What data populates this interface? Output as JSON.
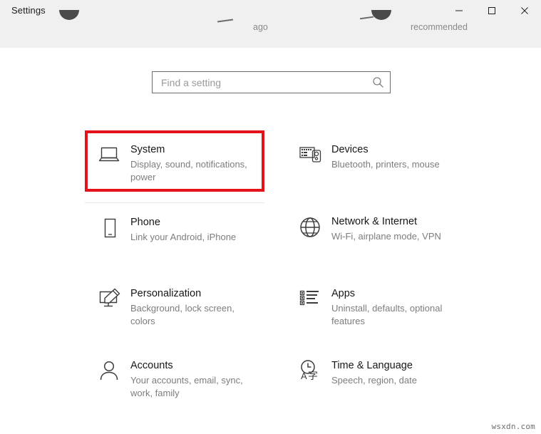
{
  "window": {
    "title": "Settings",
    "controls": [
      {
        "name": "minimize",
        "glyph": "minimize-icon"
      },
      {
        "name": "maximize",
        "glyph": "maximize-icon"
      },
      {
        "name": "close",
        "glyph": "close-icon"
      }
    ]
  },
  "clipped_row": {
    "fragment_ago": "ago",
    "fragment_recommended": "recommended"
  },
  "search": {
    "placeholder": "Find a setting",
    "value": "",
    "icon": "search-icon"
  },
  "highlight": {
    "color": "#e4121a",
    "target": "System"
  },
  "tiles": [
    {
      "id": "system",
      "icon": "laptop-icon",
      "title": "System",
      "subtitle": "Display, sound, notifications, power",
      "highlighted": true
    },
    {
      "id": "devices",
      "icon": "keyboard-mouse-icon",
      "title": "Devices",
      "subtitle": "Bluetooth, printers, mouse",
      "highlighted": false
    },
    {
      "id": "phone",
      "icon": "phone-icon",
      "title": "Phone",
      "subtitle": "Link your Android, iPhone",
      "highlighted": false
    },
    {
      "id": "network",
      "icon": "globe-icon",
      "title": "Network & Internet",
      "subtitle": "Wi-Fi, airplane mode, VPN",
      "highlighted": false
    },
    {
      "id": "personalization",
      "icon": "brush-monitor-icon",
      "title": "Personalization",
      "subtitle": "Background, lock screen, colors",
      "highlighted": false
    },
    {
      "id": "apps",
      "icon": "list-icon",
      "title": "Apps",
      "subtitle": "Uninstall, defaults, optional features",
      "highlighted": false
    },
    {
      "id": "accounts",
      "icon": "person-icon",
      "title": "Accounts",
      "subtitle": "Your accounts, email, sync, work, family",
      "highlighted": false
    },
    {
      "id": "time-language",
      "icon": "clock-language-icon",
      "title": "Time & Language",
      "subtitle": "Speech, region, date",
      "highlighted": false
    }
  ],
  "watermark": "wsxdn.com"
}
